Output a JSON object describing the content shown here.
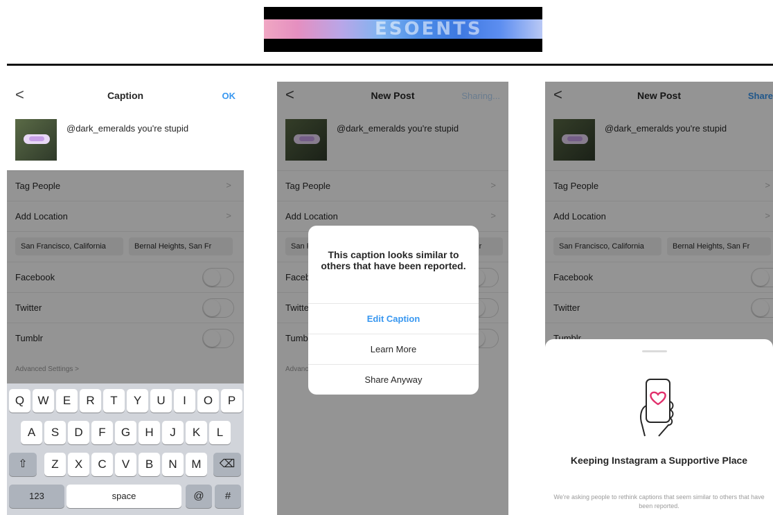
{
  "banner": {
    "text": "ESOENTS"
  },
  "screens": [
    {
      "nav": {
        "back": "<",
        "title": "Caption",
        "action": "OK"
      },
      "caption": "@dark_emeralds you're stupid",
      "rows": {
        "tag_people": "Tag People",
        "add_location": "Add Location"
      },
      "chips": [
        "San Francisco, California",
        "Bernal Heights, San Fr"
      ],
      "toggles": [
        "Facebook",
        "Twitter",
        "Tumblr"
      ],
      "advanced": "Advanced Settings >",
      "keyboard": {
        "row1": [
          "Q",
          "W",
          "E",
          "R",
          "T",
          "Y",
          "U",
          "I",
          "O",
          "P"
        ],
        "row2": [
          "A",
          "S",
          "D",
          "F",
          "G",
          "H",
          "J",
          "K",
          "L"
        ],
        "row3": [
          "Z",
          "X",
          "C",
          "V",
          "B",
          "N",
          "M"
        ],
        "shift": "⇧",
        "backspace": "⌫",
        "numbers": "123",
        "space": "space",
        "at": "@",
        "hash": "#"
      }
    },
    {
      "nav": {
        "back": "<",
        "title": "New Post",
        "action": "Sharing..."
      },
      "caption": "@dark_emeralds you're stupid",
      "rows": {
        "tag_people": "Tag People",
        "add_location": "Add Location"
      },
      "chips": [
        "San Francisco, California",
        "Bernal Heights, San Fr"
      ],
      "toggles": [
        "Facebook",
        "Twitter",
        "Tumblr"
      ],
      "advanced": "Advanced Settings >",
      "alert": {
        "message": "This caption looks similar to others that have been reported.",
        "edit": "Edit Caption",
        "learn": "Learn More",
        "share": "Share Anyway"
      }
    },
    {
      "nav": {
        "back": "<",
        "title": "New Post",
        "action": "Share"
      },
      "caption": "@dark_emeralds you're stupid",
      "rows": {
        "tag_people": "Tag People",
        "add_location": "Add Location"
      },
      "chips": [
        "San Francisco, California",
        "Bernal Heights, San Fr"
      ],
      "toggles": [
        "Facebook",
        "Twitter",
        "Tumblr"
      ],
      "sheet": {
        "title": "Keeping Instagram a Supportive Place",
        "body": "We're asking people to rethink captions that seem similar to others that have been reported."
      }
    }
  ],
  "colors": {
    "accent": "#3897f0",
    "text": "#262626",
    "overlay": "rgba(0,0,0,0.42)"
  }
}
